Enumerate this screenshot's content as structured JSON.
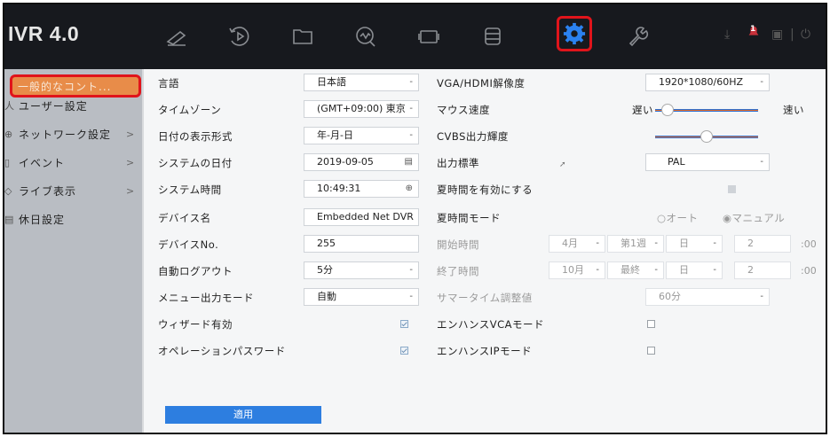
{
  "app": {
    "brand": "IVR 4.0"
  },
  "topnav": {
    "items": [
      {
        "name": "live-view-icon"
      },
      {
        "name": "playback-icon"
      },
      {
        "name": "file-management-icon"
      },
      {
        "name": "smart-analysis-icon"
      },
      {
        "name": "camera-icon"
      },
      {
        "name": "storage-icon"
      },
      {
        "name": "configuration-gear-icon",
        "selected": true
      },
      {
        "name": "maintenance-wrench-icon"
      }
    ],
    "right_icons": [
      "download-icon",
      "alarm-icon",
      "document-icon",
      "power-icon"
    ],
    "alarm_badge": "1",
    "separator": "|"
  },
  "sidebar": {
    "items": [
      {
        "label": "一般的なコント...",
        "active": true,
        "icon": "",
        "chevron": ""
      },
      {
        "label": "ユーザー設定",
        "icon": "人",
        "chevron": ""
      },
      {
        "label": "ネットワーク設定",
        "icon": "⊕",
        "chevron": ">"
      },
      {
        "label": "イベント",
        "icon": "▯",
        "chevron": ">"
      },
      {
        "label": "ライブ表示",
        "icon": "◇",
        "chevron": ">"
      },
      {
        "label": "休日設定",
        "icon": "▤",
        "chevron": ""
      }
    ]
  },
  "left": {
    "language": {
      "label": "言語",
      "value": "日本語"
    },
    "timezone": {
      "label": "タイムゾーン",
      "value": "(GMT+09:00) 東京"
    },
    "date_format": {
      "label": "日付の表示形式",
      "value": "年-月-日"
    },
    "system_date": {
      "label": "システムの日付",
      "value": "2019-09-05"
    },
    "system_time": {
      "label": "システム時間",
      "value": "10:49:31"
    },
    "device_name": {
      "label": "デバイス名",
      "value": "Embedded Net DVR"
    },
    "device_no": {
      "label": "デバイスNo.",
      "value": "255"
    },
    "auto_logout": {
      "label": "自動ログアウト",
      "value": "5分"
    },
    "menu_output": {
      "label": "メニュー出力モード",
      "value": "自動"
    },
    "wizard": {
      "label": "ウィザード有効",
      "checked": true
    },
    "operation_password": {
      "label": "オペレーションパスワード",
      "checked": true
    }
  },
  "right": {
    "resolution": {
      "label": "VGA/HDMI解像度",
      "value": "1920*1080/60HZ"
    },
    "mouse_speed": {
      "label": "マウス速度",
      "slow": "遅い",
      "fast": "速い",
      "level": 0.06
    },
    "cvbs_brightness": {
      "label": "CVBS出力輝度",
      "level": 0.5
    },
    "output_standard": {
      "label": "出力標準",
      "value": "PAL"
    },
    "dst_enable": {
      "label": "夏時間を有効にする",
      "checked": false
    },
    "dst_mode": {
      "label": "夏時間モード",
      "auto": "オート",
      "manual": "マニュアル",
      "selected": "manual"
    },
    "start_time": {
      "label": "開始時間",
      "month": "4月",
      "week": "第1週",
      "day": "日",
      "hour": "2",
      "suffix": ":00"
    },
    "end_time": {
      "label": "終了時間",
      "month": "10月",
      "week": "最終",
      "day": "日",
      "hour": "2",
      "suffix": ":00"
    },
    "dst_bias": {
      "label": "サマータイム調整値",
      "value": "60分"
    },
    "enhanced_vca": {
      "label": "エンハンスVCAモード",
      "checked": false
    },
    "enhanced_ip": {
      "label": "エンハンスIPモード",
      "checked": false
    }
  },
  "apply_label": "適用",
  "colors": {
    "accent": "#2d7ee0",
    "highlight": "#e0141b",
    "active_tab": "#e88c49"
  }
}
